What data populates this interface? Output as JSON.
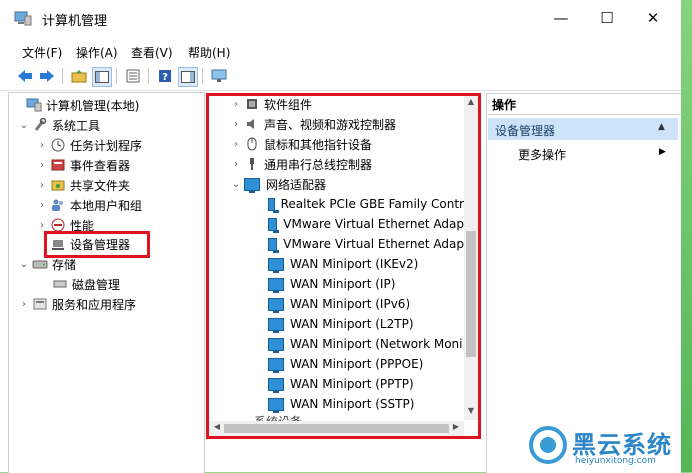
{
  "window": {
    "title": "计算机管理",
    "controls": {
      "minimize": "—",
      "maximize": "☐",
      "close": "✕"
    }
  },
  "menu": [
    {
      "label": "文件(F)"
    },
    {
      "label": "操作(A)"
    },
    {
      "label": "查看(V)"
    },
    {
      "label": "帮助(H)"
    }
  ],
  "toolbar": {
    "icons": [
      "back-icon",
      "forward-icon",
      "up-folder-icon",
      "show-tree-icon",
      "list-icon",
      "help-icon",
      "properties-icon",
      "monitor-icon"
    ]
  },
  "left_tree": {
    "root": "计算机管理(本地)",
    "system_tools": "系统工具",
    "items": [
      {
        "label": "任务计划程序"
      },
      {
        "label": "事件查看器"
      },
      {
        "label": "共享文件夹"
      },
      {
        "label": "本地用户和组"
      },
      {
        "label": "性能"
      },
      {
        "label": "设备管理器"
      }
    ],
    "storage": "存储",
    "disk": "磁盘管理",
    "services": "服务和应用程序"
  },
  "device_tree": {
    "top_items": [
      {
        "label": "软件组件"
      },
      {
        "label": "声音、视频和游戏控制器"
      },
      {
        "label": "鼠标和其他指针设备"
      },
      {
        "label": "通用串行总线控制器"
      }
    ],
    "network_group": "网络适配器",
    "adapters": [
      {
        "label": "Realtek PCIe GBE Family Contr"
      },
      {
        "label": "VMware Virtual Ethernet Adap"
      },
      {
        "label": "VMware Virtual Ethernet Adap"
      },
      {
        "label": "WAN Miniport (IKEv2)"
      },
      {
        "label": "WAN Miniport (IP)"
      },
      {
        "label": "WAN Miniport (IPv6)"
      },
      {
        "label": "WAN Miniport (L2TP)"
      },
      {
        "label": "WAN Miniport (Network Moni"
      },
      {
        "label": "WAN Miniport (PPPOE)"
      },
      {
        "label": "WAN Miniport (PPTP)"
      },
      {
        "label": "WAN Miniport (SSTP)"
      }
    ],
    "next_partial": "系统设备"
  },
  "actions": {
    "header": "操作",
    "selected": "设备管理器",
    "more": "更多操作"
  },
  "watermark": {
    "brand": "黑云系统",
    "url": "heiyunxitong.com"
  }
}
